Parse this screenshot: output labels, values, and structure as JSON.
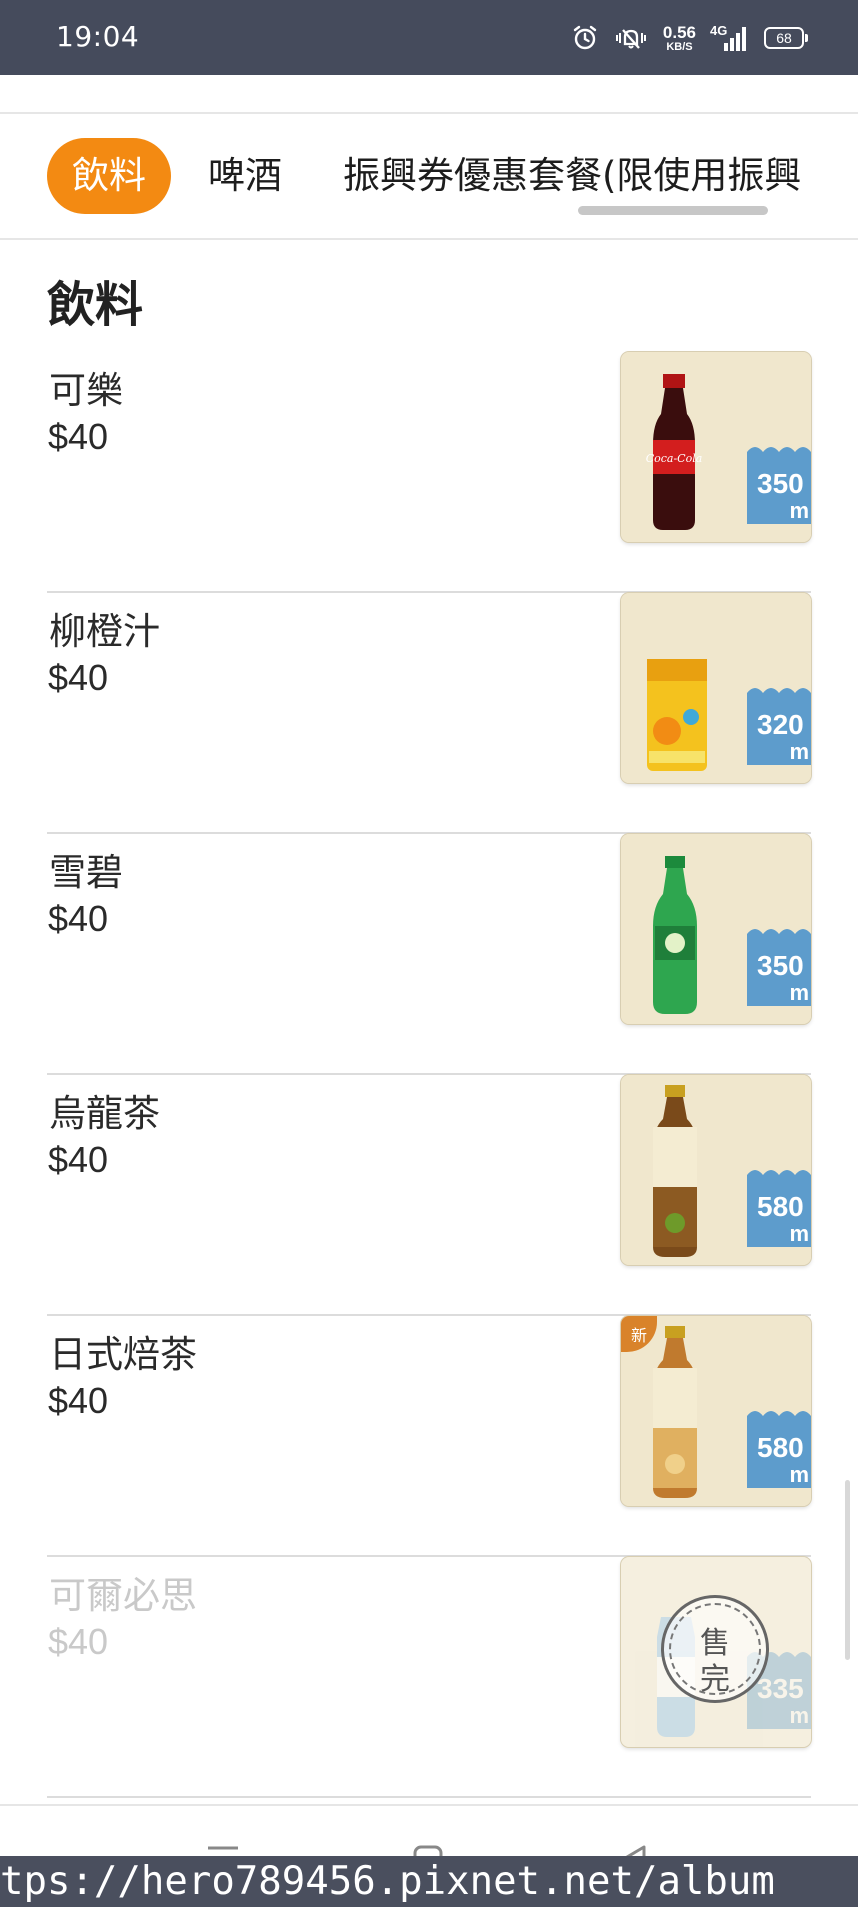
{
  "status_bar": {
    "time": "19:04",
    "net_speed_value": "0.56",
    "net_speed_unit": "KB/S",
    "network_label": "4G",
    "battery": "68",
    "icons": [
      "alarm-icon",
      "mute-vibrate-icon",
      "signal-icon",
      "battery-icon"
    ]
  },
  "tabs": [
    {
      "label": "飲料",
      "active": true
    },
    {
      "label": "啤酒",
      "active": false
    },
    {
      "label": "振興券優惠套餐(限使用振興",
      "active": false
    }
  ],
  "section": {
    "title": "飲料"
  },
  "items": [
    {
      "name": "可樂",
      "price": "$40",
      "volume_num": "350",
      "volume_unit": "m",
      "sold_out": false,
      "image": "cola-bottle"
    },
    {
      "name": "柳橙汁",
      "price": "$40",
      "volume_num": "320",
      "volume_unit": "m",
      "sold_out": false,
      "image": "orange-juice-can"
    },
    {
      "name": "雪碧",
      "price": "$40",
      "volume_num": "350",
      "volume_unit": "m",
      "sold_out": false,
      "image": "sprite-bottle"
    },
    {
      "name": "烏龍茶",
      "price": "$40",
      "volume_num": "580",
      "volume_unit": "m",
      "sold_out": false,
      "image": "oolong-tea-bottle"
    },
    {
      "name": "日式焙茶",
      "price": "$40",
      "volume_num": "580",
      "volume_unit": "m",
      "sold_out": false,
      "image": "hojicha-bottle",
      "badge": "新"
    },
    {
      "name": "可爾必思",
      "price": "$40",
      "volume_num": "335",
      "volume_unit": "m",
      "sold_out": true,
      "image": "calpis-bottle",
      "sold_out_text": [
        "售",
        "完"
      ]
    }
  ],
  "watermark": "tps://hero789456.pixnet.net/album",
  "colors": {
    "accent": "#f38a12",
    "status_bar": "#454b5c",
    "volume_tag": "#5d9ccc",
    "thumb_bg": "#efe6cb"
  }
}
